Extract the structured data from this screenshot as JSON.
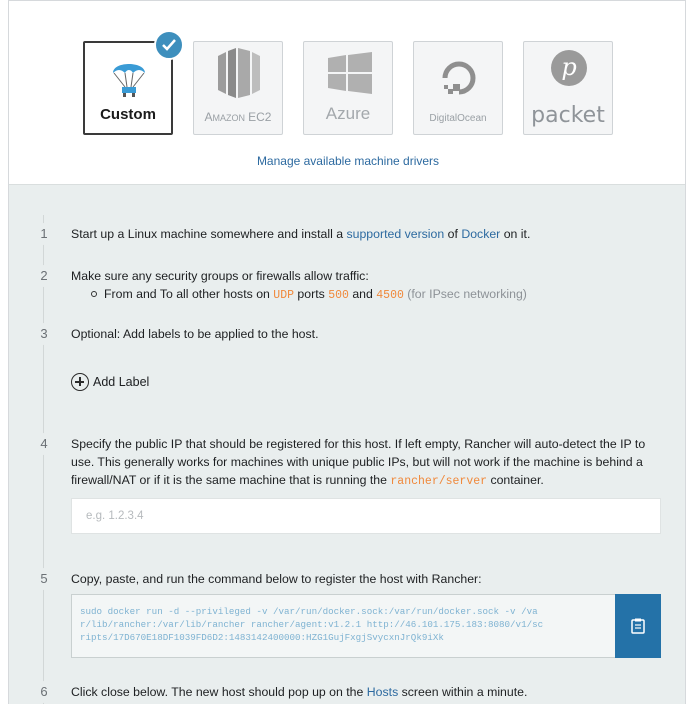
{
  "drivers": [
    {
      "name": "Custom",
      "icon": "parachute-icon",
      "selected": true
    },
    {
      "name": "Amazon EC2",
      "icon": "ec2-icon",
      "selected": false
    },
    {
      "name": "Azure",
      "icon": "windows-icon",
      "selected": false
    },
    {
      "name": "DigitalOcean",
      "icon": "digitalocean-icon",
      "selected": false
    },
    {
      "name": "packet",
      "icon": "packet-icon",
      "selected": false
    }
  ],
  "manage_link": "Manage available machine drivers",
  "steps": {
    "s1": {
      "num": "1",
      "pre": "Start up a Linux machine somewhere and install a ",
      "link1": "supported version",
      "mid": " of ",
      "link2": "Docker",
      "post": " on it."
    },
    "s2": {
      "num": "2",
      "text": "Make sure any security groups or firewalls allow traffic:",
      "bullet_pre": "From and To all other hosts on ",
      "proto": "UDP",
      "ports_word": " ports ",
      "port1": "500",
      "and_word": " and ",
      "port2": "4500",
      "note": " (for IPsec networking)"
    },
    "s3": {
      "num": "3",
      "text": "Optional: Add labels to be applied to the host.",
      "add_label": "Add Label"
    },
    "s4": {
      "num": "4",
      "text": "Specify the public IP that should be registered for this host. If left empty, Rancher will auto-detect the IP to use. This generally works for machines with unique public IPs, but will not work if the machine is behind a firewall/NAT or if it is the same machine that is running the ",
      "container_code": "rancher/server",
      "post": " container.",
      "ip_placeholder": "e.g. 1.2.3.4",
      "ip_value": ""
    },
    "s5": {
      "num": "5",
      "text": "Copy, paste, and run the command below to register the host with Rancher:",
      "command": "sudo docker run -d --privileged -v /var/run/docker.sock:/var/run/docker.sock -v /va\nr/lib/rancher:/var/lib/rancher rancher/agent:v1.2.1 http://46.101.175.183:8080/v1/sc\nripts/17D670E18DF1039FD6D2:1483142400000:HZG1GujFxgjSvycxnJrQk9iXk"
    },
    "s6": {
      "num": "6",
      "pre": "Click close below. The new host should pop up on the ",
      "link": "Hosts",
      "post": " screen within a minute."
    }
  },
  "colors": {
    "accent": "#2472a8",
    "check": "#3e8fbd",
    "code_orange": "#f0883a",
    "panel_bg": "#e9eeee"
  }
}
